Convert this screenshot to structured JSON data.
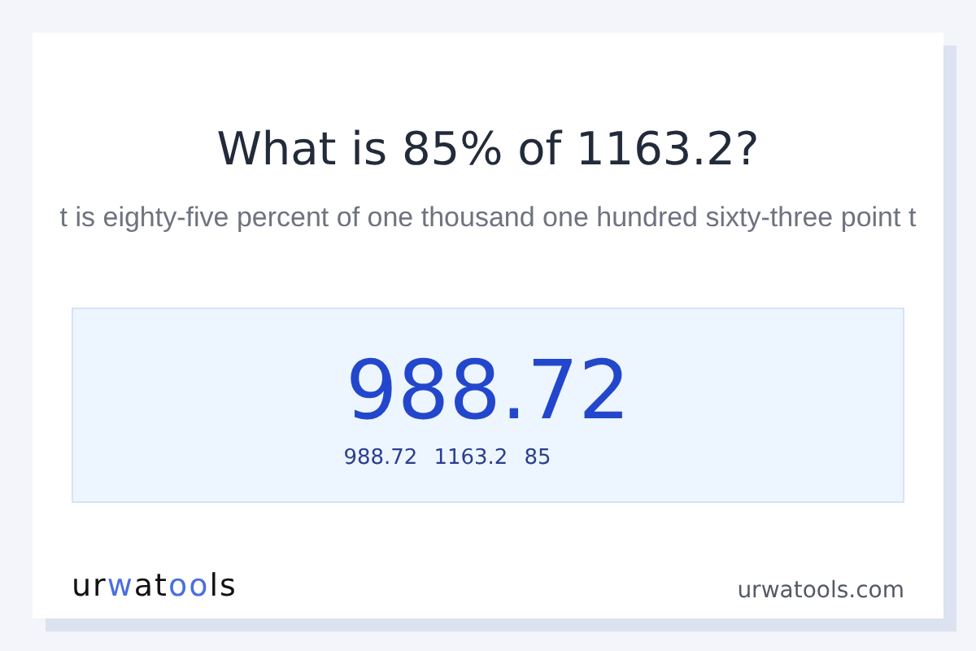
{
  "title": "What is 85% of 1163.2?",
  "subtitle": "t is eighty-five percent of one thousand one hundred sixty-three point t",
  "result": {
    "value": "988.72",
    "parts": [
      "988.72",
      "1163.2",
      "85"
    ]
  },
  "logo": [
    {
      "text": "ur",
      "accent": false
    },
    {
      "text": "w",
      "accent": true
    },
    {
      "text": "at",
      "accent": false
    },
    {
      "text": "oo",
      "accent": true
    },
    {
      "text": "ls",
      "accent": false
    }
  ],
  "site": "urwatools.com"
}
